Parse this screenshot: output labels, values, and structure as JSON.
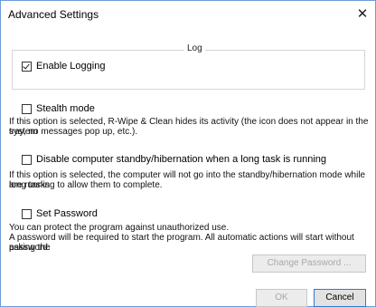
{
  "window": {
    "title": "Advanced Settings",
    "close_glyph": "✕"
  },
  "log_group": {
    "legend": "Log",
    "enable_logging_label": "Enable Logging",
    "enable_logging_checked": true
  },
  "stealth": {
    "label": "Stealth mode",
    "checked": false,
    "description_line1": "If this option is selected, R-Wipe & Clean hides its activity (the icon does not appear in the system",
    "description_line2": "tray, no messages pop up, etc.)."
  },
  "standby": {
    "label": "Disable computer standby/hibernation when a long task is running",
    "checked": false,
    "description_line1": "If this option is selected, the computer will not go into the standby/hibernation mode while long tasks",
    "description_line2": "are running to allow them to complete."
  },
  "password": {
    "label": "Set Password",
    "checked": false,
    "description_line1": "You can protect the program against unauthorized use.",
    "description_line2": "A password will be required to start the program. All automatic actions will start without asking the",
    "description_line3": "password.",
    "change_button": "Change Password ..."
  },
  "footer": {
    "ok_label": "OK",
    "cancel_label": "Cancel"
  }
}
